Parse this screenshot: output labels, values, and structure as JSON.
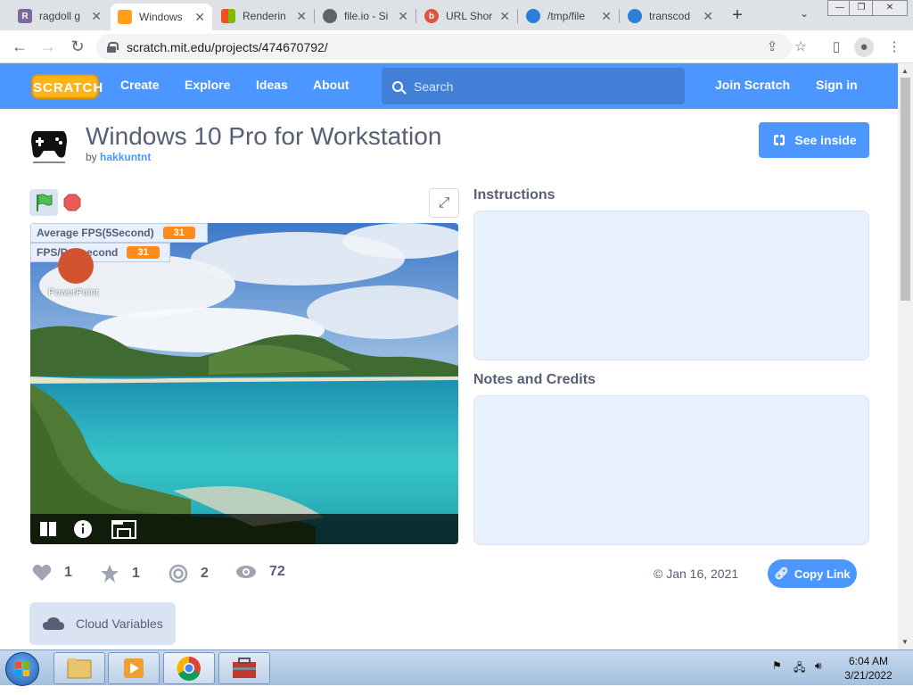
{
  "browser": {
    "tabs": [
      {
        "label": "ragdoll g",
        "color": "#7b6a9c",
        "glyph": "R"
      },
      {
        "label": "Windows",
        "color": "#ff9f1a",
        "glyph": "§"
      },
      {
        "label": "Renderin",
        "color": "#f25022",
        "glyph": ""
      },
      {
        "label": "file.io - Si",
        "color": "#5f6368",
        "glyph": "◎"
      },
      {
        "label": "URL Shor",
        "color": "#e0553a",
        "glyph": "b"
      },
      {
        "label": "/tmp/file",
        "color": "#2b7fd8",
        "glyph": "☁"
      },
      {
        "label": "transcod",
        "color": "#2b7fd8",
        "glyph": "☁"
      }
    ],
    "url": "scratch.mit.edu/projects/474670792/"
  },
  "nav": {
    "logo": "SCRATCH",
    "links": [
      "Create",
      "Explore",
      "Ideas",
      "About"
    ],
    "search_placeholder": "Search",
    "join": "Join Scratch",
    "signin": "Sign in"
  },
  "project": {
    "title": "Windows 10 Pro for Workstation",
    "by": "by",
    "author": "hakkuntnt",
    "see_inside": "See inside",
    "monitors": [
      {
        "label": "Average FPS(5Second)",
        "value": "31"
      },
      {
        "label": "FPS/Per second",
        "value": "31"
      }
    ],
    "powerpoint_label": "PowerPoint",
    "instructions_title": "Instructions",
    "notes_title": "Notes and Credits",
    "stats": {
      "loves": "1",
      "favorites": "1",
      "remixes": "2",
      "views": "72"
    },
    "date": "© Jan 16, 2021",
    "copy_link": "Copy Link",
    "cloud_variables": "Cloud Variables"
  },
  "taskbar": {
    "time": "6:04 AM",
    "date": "3/21/2022"
  }
}
